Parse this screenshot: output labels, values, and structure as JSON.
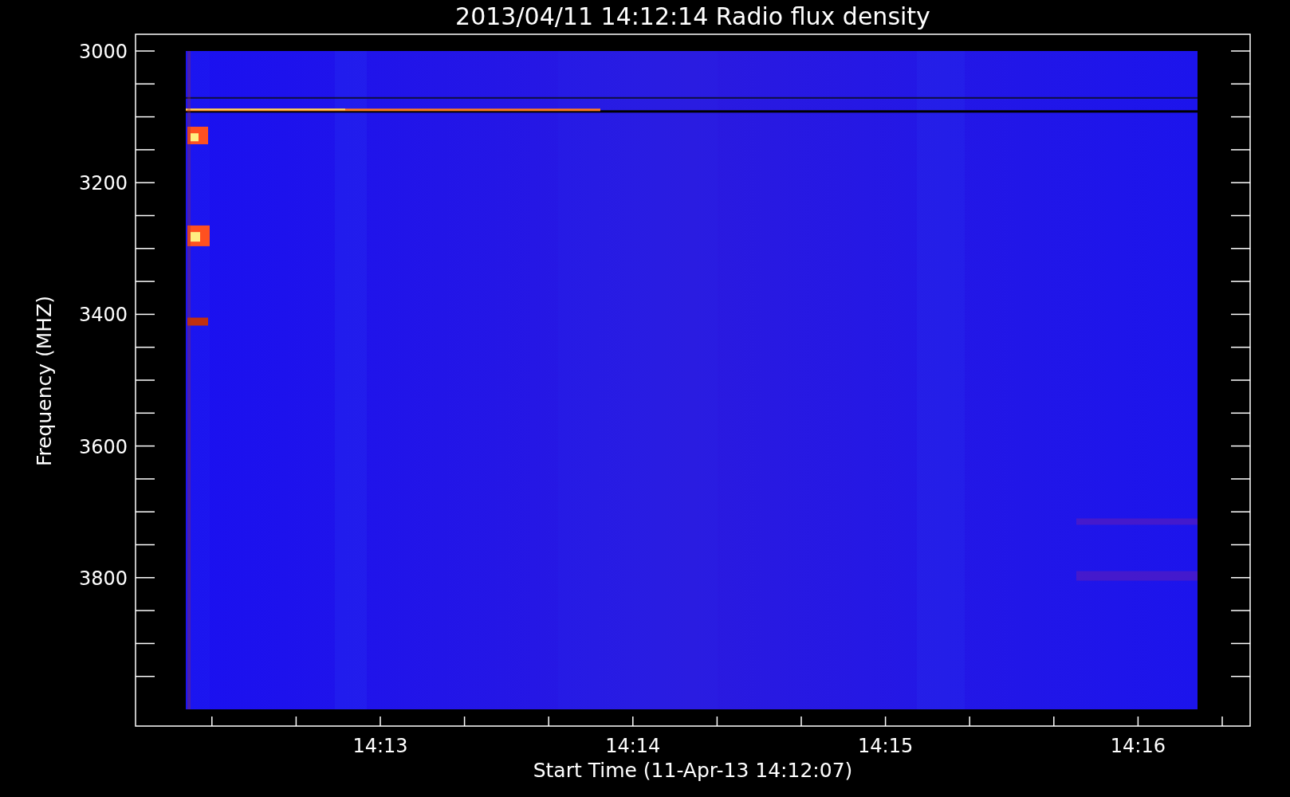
{
  "plot": {
    "title": "2013/04/11 14:12:14 Radio flux density",
    "y_axis": {
      "label": "Frequency (MHZ)",
      "ticks": [
        "3000",
        "3200",
        "3400",
        "3600",
        "3800"
      ]
    },
    "x_axis": {
      "label": "Start Time (11-Apr-13 14:12:07)",
      "ticks": [
        "14:13",
        "14:14",
        "14:15",
        "14:16"
      ]
    }
  }
}
